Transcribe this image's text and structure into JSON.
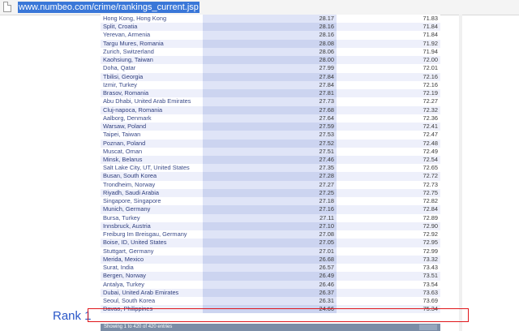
{
  "address_bar": {
    "url": "www.numbeo.com/crime/rankings_current.jsp"
  },
  "table": {
    "rows": [
      {
        "city": "Hong Kong, Hong Kong",
        "crime_index": "28.17",
        "safety_index": "71.83"
      },
      {
        "city": "Split, Croatia",
        "crime_index": "28.16",
        "safety_index": "71.84"
      },
      {
        "city": "Yerevan, Armenia",
        "crime_index": "28.16",
        "safety_index": "71.84"
      },
      {
        "city": "Targu Mures, Romania",
        "crime_index": "28.08",
        "safety_index": "71.92"
      },
      {
        "city": "Zurich, Switzerland",
        "crime_index": "28.06",
        "safety_index": "71.94"
      },
      {
        "city": "Kaohsiung, Taiwan",
        "crime_index": "28.00",
        "safety_index": "72.00"
      },
      {
        "city": "Doha, Qatar",
        "crime_index": "27.99",
        "safety_index": "72.01"
      },
      {
        "city": "Tbilisi, Georgia",
        "crime_index": "27.84",
        "safety_index": "72.16"
      },
      {
        "city": "Izmir, Turkey",
        "crime_index": "27.84",
        "safety_index": "72.16"
      },
      {
        "city": "Brasov, Romania",
        "crime_index": "27.81",
        "safety_index": "72.19"
      },
      {
        "city": "Abu Dhabi, United Arab Emirates",
        "crime_index": "27.73",
        "safety_index": "72.27"
      },
      {
        "city": "Cluj-napoca, Romania",
        "crime_index": "27.68",
        "safety_index": "72.32"
      },
      {
        "city": "Aalborg, Denmark",
        "crime_index": "27.64",
        "safety_index": "72.36"
      },
      {
        "city": "Warsaw, Poland",
        "crime_index": "27.59",
        "safety_index": "72.41"
      },
      {
        "city": "Taipei, Taiwan",
        "crime_index": "27.53",
        "safety_index": "72.47"
      },
      {
        "city": "Poznan, Poland",
        "crime_index": "27.52",
        "safety_index": "72.48"
      },
      {
        "city": "Muscat, Oman",
        "crime_index": "27.51",
        "safety_index": "72.49"
      },
      {
        "city": "Minsk, Belarus",
        "crime_index": "27.46",
        "safety_index": "72.54"
      },
      {
        "city": "Salt Lake City, UT, United States",
        "crime_index": "27.35",
        "safety_index": "72.65"
      },
      {
        "city": "Busan, South Korea",
        "crime_index": "27.28",
        "safety_index": "72.72"
      },
      {
        "city": "Trondheim, Norway",
        "crime_index": "27.27",
        "safety_index": "72.73"
      },
      {
        "city": "Riyadh, Saudi Arabia",
        "crime_index": "27.25",
        "safety_index": "72.75"
      },
      {
        "city": "Singapore, Singapore",
        "crime_index": "27.18",
        "safety_index": "72.82"
      },
      {
        "city": "Munich, Germany",
        "crime_index": "27.16",
        "safety_index": "72.84"
      },
      {
        "city": "Bursa, Turkey",
        "crime_index": "27.11",
        "safety_index": "72.89"
      },
      {
        "city": "Innsbruck, Austria",
        "crime_index": "27.10",
        "safety_index": "72.90"
      },
      {
        "city": "Freiburg Im Breisgau, Germany",
        "crime_index": "27.08",
        "safety_index": "72.92"
      },
      {
        "city": "Boise, ID, United States",
        "crime_index": "27.05",
        "safety_index": "72.95"
      },
      {
        "city": "Stuttgart, Germany",
        "crime_index": "27.01",
        "safety_index": "72.99"
      },
      {
        "city": "Merida, Mexico",
        "crime_index": "26.68",
        "safety_index": "73.32"
      },
      {
        "city": "Surat, India",
        "crime_index": "26.57",
        "safety_index": "73.43"
      },
      {
        "city": "Bergen, Norway",
        "crime_index": "26.49",
        "safety_index": "73.51"
      },
      {
        "city": "Antalya, Turkey",
        "crime_index": "26.46",
        "safety_index": "73.54"
      },
      {
        "city": "Dubai, United Arab Emirates",
        "crime_index": "26.37",
        "safety_index": "73.63"
      },
      {
        "city": "Seoul, South Korea",
        "crime_index": "26.31",
        "safety_index": "73.69"
      },
      {
        "city": "Davao, Philippines",
        "crime_index": "24.66",
        "safety_index": "75.34"
      }
    ]
  },
  "footer": {
    "info": "Showing 1 to 420 of 420 entries"
  },
  "annotation": {
    "label": "Rank 1",
    "color": "#e0161b"
  }
}
